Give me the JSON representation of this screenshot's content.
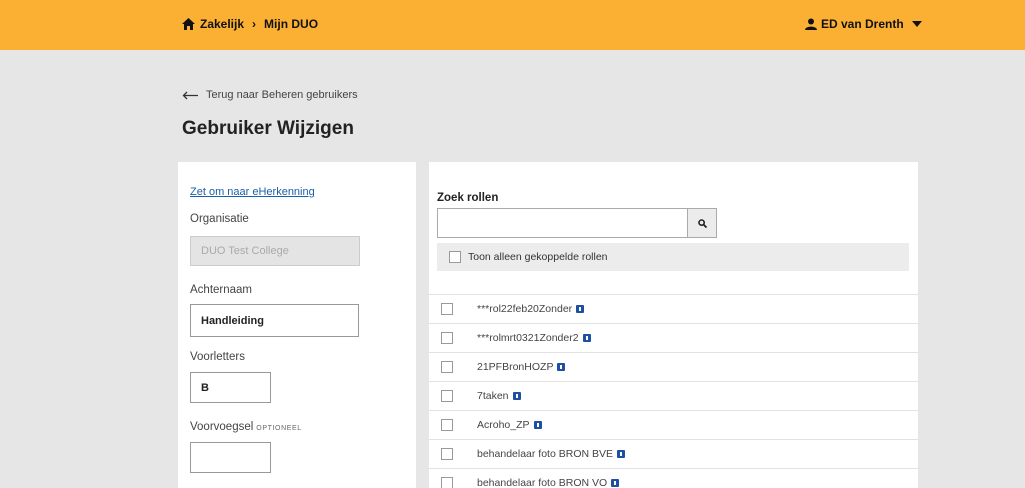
{
  "topbar": {
    "crumbs": [
      "Zakelijk",
      "Mijn DUO"
    ],
    "separator": "›",
    "user_name": "ED van Drenth"
  },
  "back_link": "Terug naar Beheren gebruikers",
  "page_title": "Gebruiker Wijzigen",
  "left_form": {
    "convert_link": "Zet om naar eHerkenning",
    "organisatie_label": "Organisatie",
    "organisatie_value": "DUO Test College",
    "achternaam_label": "Achternaam",
    "achternaam_value": "Handleiding",
    "voorletters_label": "Voorletters",
    "voorletters_value": "B",
    "voorvoegsel_label": "Voorvoegsel",
    "optional_tag": "OPTIONEEL",
    "voorvoegsel_value": ""
  },
  "roles_panel": {
    "search_label": "Zoek rollen",
    "search_value": "",
    "filter_label": "Toon alleen gekoppelde rollen",
    "roles": [
      "***rol22feb20Zonder",
      "***rolmrt0321Zonder2",
      "21PFBronHOZP",
      "7taken",
      "Acroho_ZP",
      "behandelaar foto BRON BVE",
      "behandelaar foto BRON VO"
    ]
  },
  "colors": {
    "topbar": "#fbb034",
    "background": "#e6e6e6",
    "link": "#1a5fa8",
    "info_icon": "#1d4fa3"
  }
}
